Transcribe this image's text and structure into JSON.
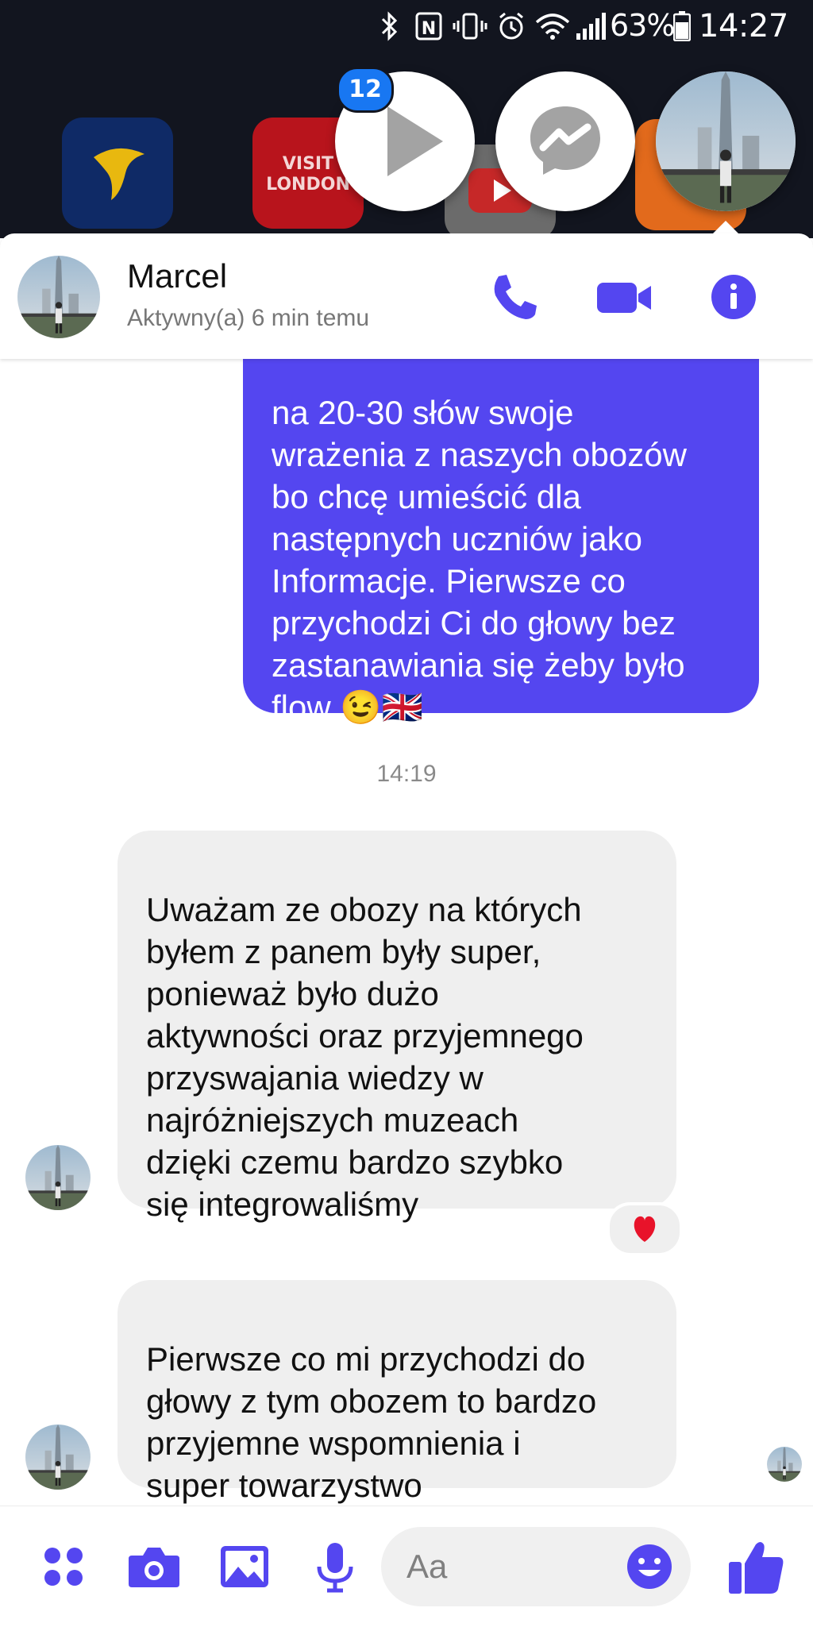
{
  "status_bar": {
    "battery": "63%",
    "time": "14:27"
  },
  "chat_heads": {
    "badge_count": "12",
    "background_tile_text": "VISIT\nLONDON"
  },
  "header": {
    "contact_name": "Marcel",
    "contact_status": "Aktywny(a) 6 min temu"
  },
  "messages": {
    "sent_text": "na 20-30 słów swoje\nwrażenia z naszych obozów\nbo chcę umieścić dla\nnastępnych uczniów jako\nInformacje. Pierwsze co\nprzychodzi Ci do głowy bez\nzastanawiania się żeby było\nflow 😉🇬🇧",
    "timestamp": "14:19",
    "received_1": "Uważam ze obozy na których\nbyłem z panem były super,\nponieważ było dużo\naktywności oraz przyjemnego\nprzyswajania wiedzy w\nnajróżniejszych muzeach\ndzięki czemu bardzo szybko\nsię integrowaliśmy",
    "received_2": "Pierwsze co mi przychodzi do\ngłowy z tym obozem to bardzo\nprzyjemne wspomnienia i\nsuper towarzystwo",
    "reaction": "heart"
  },
  "composer": {
    "placeholder": "Aa"
  },
  "colors": {
    "accent": "#5446f0",
    "sent_bubble": "#5446f0",
    "received_bubble": "#efefef",
    "top_background": "#12151f"
  },
  "icons": [
    "bluetooth-icon",
    "nfc-icon",
    "vibrate-icon",
    "alarm-icon",
    "wifi-icon",
    "signal-icon",
    "battery-icon",
    "play-icon",
    "messenger-icon",
    "phone-icon",
    "video-icon",
    "info-icon",
    "apps-icon",
    "camera-icon",
    "image-icon",
    "microphone-icon",
    "emoji-icon",
    "thumbs-up-icon",
    "heart-icon"
  ]
}
